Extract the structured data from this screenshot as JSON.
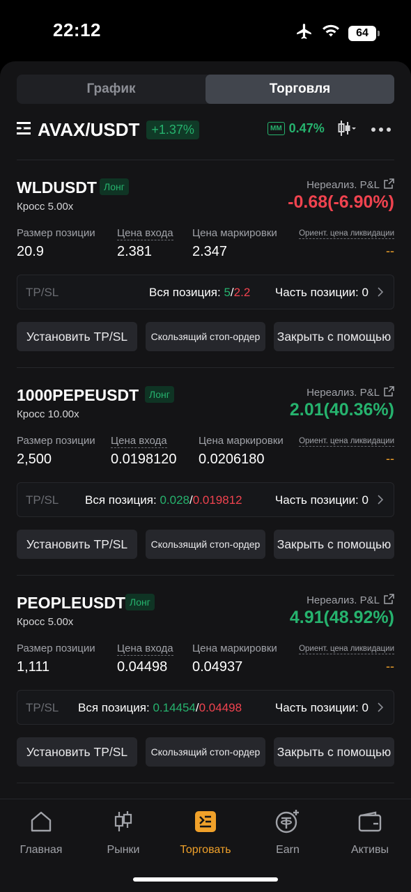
{
  "status_bar": {
    "time": "22:12",
    "battery": "64"
  },
  "segment": {
    "tabs": [
      "График",
      "Торговля"
    ],
    "active": 1
  },
  "pair": {
    "symbol": "AVAX/USDT",
    "change": "+1.37%",
    "mm_label": "MM",
    "mm_value": "0.47%"
  },
  "labels": {
    "pnl": "Нереализ. P&L",
    "size": "Размер позиции",
    "entry": "Цена входа",
    "mark": "Цена маркировки",
    "liq": "Ориент. цена ликвидации",
    "tpsl": "TP/SL",
    "all": "Вся позиция:",
    "part": "Часть позиции:",
    "set_tpsl": "Установить TP/SL",
    "trailing": "Скользящий стоп-ордер",
    "close": "Закрыть с помощью",
    "long": "Лонг"
  },
  "positions": [
    {
      "symbol": "WLDUSDT",
      "margin": "Кросс 5.00x",
      "pnl": "-0.68(-6.90%)",
      "size": "20.9",
      "entry": "2.381",
      "mark": "2.347",
      "liq": "--",
      "tp": "5",
      "sl": "2.2",
      "part": "0"
    },
    {
      "symbol": "1000PEPEUSDT",
      "margin": "Кросс 10.00x",
      "pnl": "2.01(40.36%)",
      "size": "2,500",
      "entry": "0.0198120",
      "mark": "0.0206180",
      "liq": "--",
      "tp": "0.028",
      "sl": "0.019812",
      "part": "0"
    },
    {
      "symbol": "PEOPLEUSDT",
      "margin": "Кросс 5.00x",
      "pnl": "4.91(48.92%)",
      "size": "1,111",
      "entry": "0.04498",
      "mark": "0.04937",
      "liq": "--",
      "tp": "0.14454",
      "sl": "0.04498",
      "part": "0"
    }
  ],
  "tabbar": [
    {
      "label": "Главная",
      "icon": "home-icon"
    },
    {
      "label": "Рынки",
      "icon": "candles-icon"
    },
    {
      "label": "Торговать",
      "icon": "trade-icon"
    },
    {
      "label": "Earn",
      "icon": "earn-icon"
    },
    {
      "label": "Активы",
      "icon": "wallet-icon"
    }
  ],
  "colors": {
    "green": "#26b36e",
    "red": "#f0434f",
    "orange": "#f0a12a",
    "bg": "#141416"
  }
}
